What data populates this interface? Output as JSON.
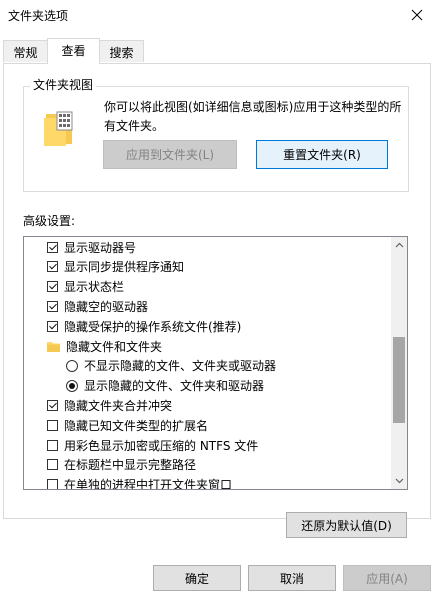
{
  "window": {
    "title": "文件夹选项"
  },
  "tabs": [
    {
      "label": "常规"
    },
    {
      "label": "查看"
    },
    {
      "label": "搜索"
    }
  ],
  "folder_views": {
    "legend": "文件夹视图",
    "description": "你可以将此视图(如详细信息或图标)应用于这种类型的所有文件夹。",
    "apply_button": "应用到文件夹(L)",
    "reset_button": "重置文件夹(R)"
  },
  "advanced": {
    "label": "高级设置:",
    "items": [
      {
        "type": "checkbox",
        "checked": true,
        "label": "显示驱动器号"
      },
      {
        "type": "checkbox",
        "checked": true,
        "label": "显示同步提供程序通知"
      },
      {
        "type": "checkbox",
        "checked": true,
        "label": "显示状态栏"
      },
      {
        "type": "checkbox",
        "checked": true,
        "label": "隐藏空的驱动器"
      },
      {
        "type": "checkbox",
        "checked": true,
        "label": "隐藏受保护的操作系统文件(推荐)"
      },
      {
        "type": "folder",
        "label": "隐藏文件和文件夹",
        "icon": "folder-icon"
      },
      {
        "type": "radio",
        "selected": false,
        "label": "不显示隐藏的文件、文件夹或驱动器"
      },
      {
        "type": "radio",
        "selected": true,
        "label": "显示隐藏的文件、文件夹和驱动器"
      },
      {
        "type": "checkbox",
        "checked": true,
        "label": "隐藏文件夹合并冲突"
      },
      {
        "type": "checkbox",
        "checked": false,
        "label": "隐藏已知文件类型的扩展名"
      },
      {
        "type": "checkbox",
        "checked": false,
        "label": "用彩色显示加密或压缩的 NTFS 文件"
      },
      {
        "type": "checkbox",
        "checked": false,
        "label": "在标题栏中显示完整路径"
      },
      {
        "type": "checkbox",
        "checked": false,
        "label": "在单独的进程中打开文件夹窗口"
      }
    ]
  },
  "restore_defaults_button": "还原为默认值(D)",
  "dialog_buttons": {
    "ok": "确定",
    "cancel": "取消",
    "apply": "应用(A)"
  },
  "colors": {
    "accent": "#0078d7",
    "folder": "#ffd86a",
    "scroll_thumb": "#a6a6a6"
  }
}
